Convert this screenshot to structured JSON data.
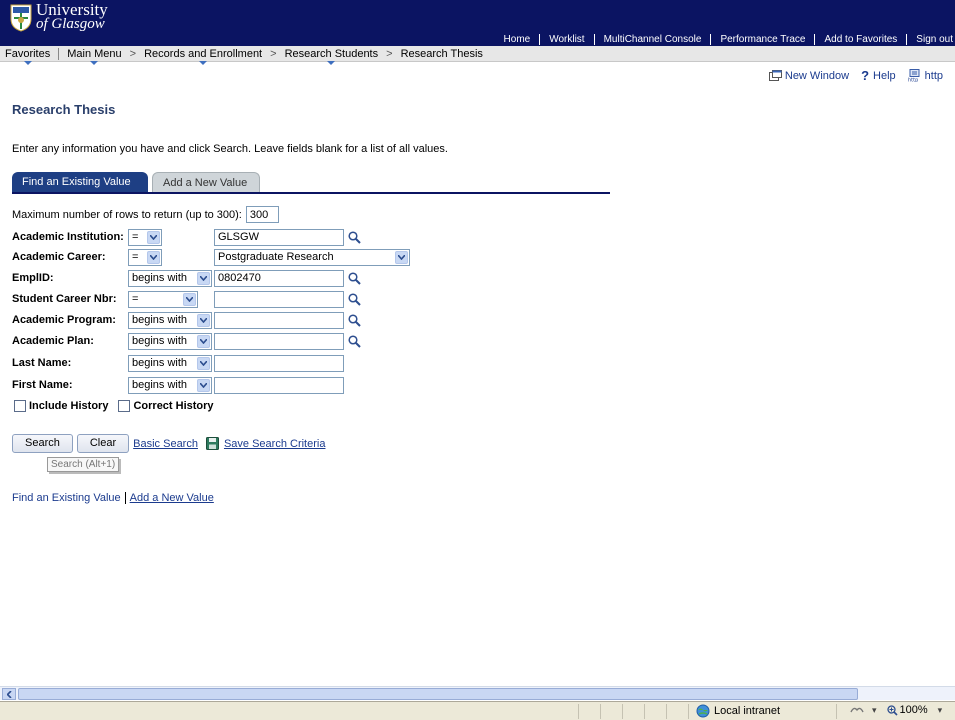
{
  "header": {
    "logo_line1": "University",
    "logo_line2": "of Glasgow",
    "links": [
      "Home",
      "Worklist",
      "MultiChannel Console",
      "Performance Trace",
      "Add to Favorites",
      "Sign out"
    ]
  },
  "breadcrumb": {
    "favorites": "Favorites",
    "main_menu": "Main Menu",
    "records": "Records and Enrollment",
    "research_students": "Research Students",
    "current": "Research Thesis",
    "separator": ">"
  },
  "page_links": {
    "new_window": "New Window",
    "help": "Help",
    "http": "http"
  },
  "page": {
    "title": "Research Thesis",
    "instructions": "Enter any information you have and click Search. Leave fields blank for a list of all values."
  },
  "tabs": {
    "find_existing": "Find an Existing Value",
    "add_new": "Add a New Value"
  },
  "form": {
    "max_rows_label": "Maximum number of rows to return (up to 300):",
    "max_rows_value": "300",
    "fields": [
      {
        "label": "Academic Institution:",
        "operator": "=",
        "value": "GLSGW"
      },
      {
        "label": "Academic Career:",
        "operator": "=",
        "value": "Postgraduate Research"
      },
      {
        "label": "EmplID:",
        "operator": "begins with",
        "value": "0802470"
      },
      {
        "label": "Student Career Nbr:",
        "operator": "=",
        "value": ""
      },
      {
        "label": "Academic Program:",
        "operator": "begins with",
        "value": ""
      },
      {
        "label": "Academic Plan:",
        "operator": "begins with",
        "value": ""
      },
      {
        "label": "Last Name:",
        "operator": "begins with",
        "value": ""
      },
      {
        "label": "First Name:",
        "operator": "begins with",
        "value": ""
      }
    ],
    "include_history": "Include History",
    "correct_history": "Correct History"
  },
  "actions": {
    "search": "Search",
    "clear": "Clear",
    "basic_search": "Basic Search",
    "save_criteria": "Save Search Criteria",
    "tooltip": "Search (Alt+1)"
  },
  "bottom_links": {
    "find_existing": "Find an Existing Value",
    "add_new": "Add a New Value"
  },
  "statusbar": {
    "zone": "Local intranet",
    "zoom": "100%"
  },
  "colors": {
    "banner": "#0b1462",
    "tab_active": "#1e3f84",
    "link": "#1b3b8e"
  }
}
